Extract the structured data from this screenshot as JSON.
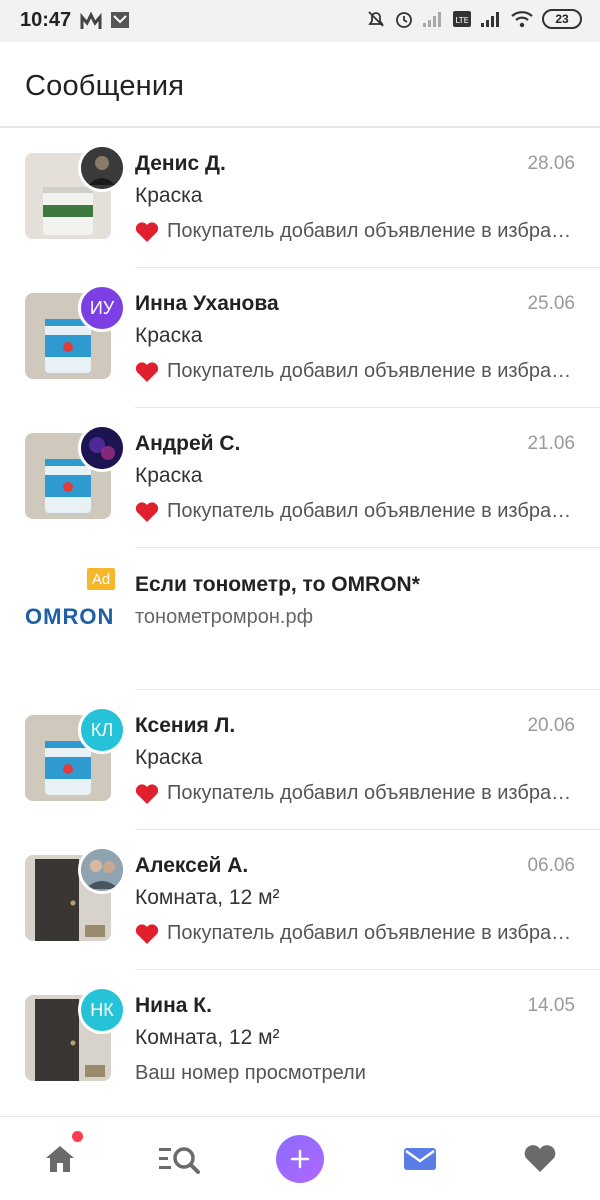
{
  "status_bar": {
    "time": "10:47",
    "battery": "23",
    "icons": [
      "notification-app-icon",
      "mail-notification-icon",
      "mute-bell-icon",
      "alarm-icon",
      "signal-icon",
      "lte-icon",
      "signal-icon-2",
      "wifi-icon"
    ]
  },
  "header": {
    "title": "Сообщения"
  },
  "conversations": [
    {
      "name": "Денис Д.",
      "date": "28.06",
      "item": "Краска",
      "message": "Покупатель добавил объявление в избранное",
      "liked": true,
      "avatar_initials": "",
      "avatar_color": "#2a2a2a",
      "thumb": "paint-can-green-label"
    },
    {
      "name": "Инна Уханова",
      "date": "25.06",
      "item": "Краска",
      "message": "Покупатель добавил объявление в избранное",
      "liked": true,
      "avatar_initials": "ИУ",
      "avatar_color": "#7b3fe4",
      "thumb": "paint-can-blue"
    },
    {
      "name": "Андрей С.",
      "date": "21.06",
      "item": "Краска",
      "message": "Покупатель добавил объявление в избранное",
      "liked": true,
      "avatar_initials": "",
      "avatar_color": "#2b1a6e",
      "thumb": "paint-can-blue"
    },
    {
      "name": "Ксения Л.",
      "date": "20.06",
      "item": "Краска",
      "message": "Покупатель добавил объявление в избранное",
      "liked": true,
      "avatar_initials": "КЛ",
      "avatar_color": "#26c3d8",
      "thumb": "paint-can-blue"
    },
    {
      "name": "Алексей А.",
      "date": "06.06",
      "item": "Комната, 12 м²",
      "message": "Покупатель добавил объявление в избранное",
      "liked": true,
      "avatar_initials": "",
      "avatar_color": "#6a7a8a",
      "thumb": "dark-door"
    },
    {
      "name": "Нина К.",
      "date": "14.05",
      "item": "Комната, 12 м²",
      "message": "Ваш номер просмотрели",
      "liked": false,
      "avatar_initials": "НК",
      "avatar_color": "#26c3d8",
      "thumb": "dark-door"
    }
  ],
  "ad": {
    "badge": "Ad",
    "logo": "OMRON",
    "title": "Если тонометр, то OMRON*",
    "url": "тонометромрон.рф"
  },
  "bottom_nav": {
    "items": [
      "home-icon",
      "search-list-icon",
      "add-icon",
      "messages-icon",
      "favorites-icon"
    ],
    "active": "messages-icon",
    "accent": "#5b7de8"
  }
}
